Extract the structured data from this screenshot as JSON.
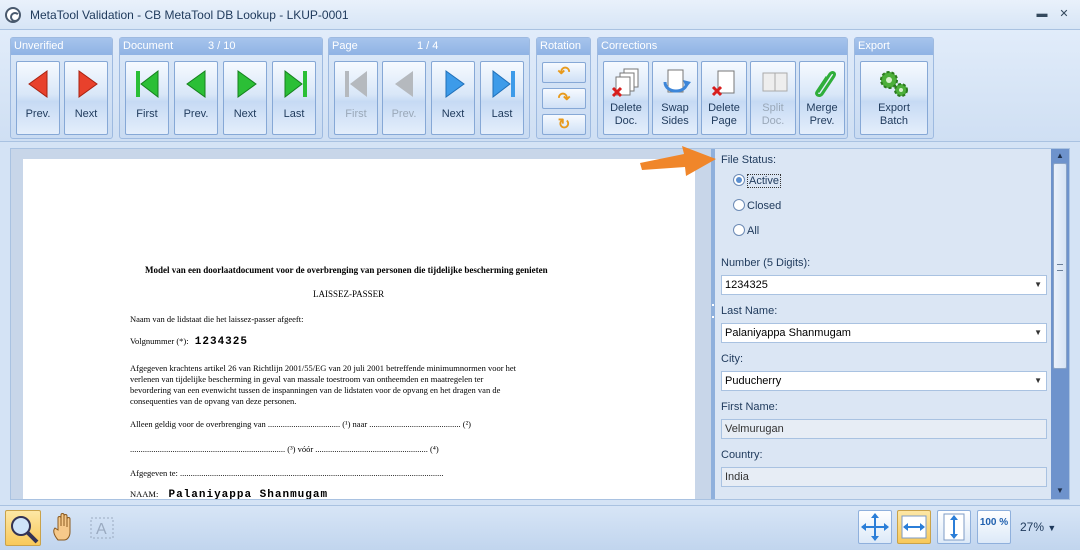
{
  "window": {
    "title": "MetaTool Validation - CB MetaTool DB Lookup - LKUP-0001"
  },
  "ribbon": {
    "unverified": {
      "title": "Unverified",
      "prev": "Prev.",
      "next": "Next"
    },
    "document": {
      "title": "Document",
      "counter": "3 / 10",
      "first": "First",
      "prev": "Prev.",
      "next": "Next",
      "last": "Last"
    },
    "page": {
      "title": "Page",
      "counter": "1 / 4",
      "first": "First",
      "prev": "Prev.",
      "next": "Next",
      "last": "Last"
    },
    "rotation": {
      "title": "Rotation"
    },
    "corrections": {
      "title": "Corrections",
      "delete_doc": [
        "Delete",
        "Doc."
      ],
      "swap_sides": [
        "Swap",
        "Sides"
      ],
      "delete_page": [
        "Delete",
        "Page"
      ],
      "split_doc": [
        "Split",
        "Doc."
      ],
      "merge_prev": [
        "Merge",
        "Prev."
      ]
    },
    "export": {
      "title": "Export",
      "export_batch": [
        "Export",
        "Batch"
      ]
    }
  },
  "document_page": {
    "heading": "Model van een doorlaatdocument voor de overbrenging van personen die tijdelijke bescherming genieten",
    "subheading": "LAISSEZ-PASSER",
    "line_1": "Naam van de lidstaat die het laissez-passer afgeeft:",
    "volgnummer_label": "Volgnummer (*):",
    "volgnummer_value": "1234325",
    "para": [
      "Afgegeven krachtens artikel 26 van Richtlijn 2001/55/EG van 20 juli 2001 betreffende minimumnormen voor het",
      "verlenen van tijdelijke bescherming in geval van massale toestroom van ontheemden en maatregelen ter",
      "bevordering van een evenwicht tussen de inspanningen van de lidstaten voor de opvang en het dragen van de",
      "consequenties van de opvang van deze personen."
    ],
    "line_geldig": "Alleen geldig voor de overbrenging van .................................. (¹)  naar ........................................... (²)",
    "line_voor": "......................................................................... (³) vóór ..................................................... (⁴)",
    "line_afgegeven": "Afgegeven te: ............................................................................................................................",
    "naam_label": "NAAM:",
    "naam_value": "Palaniyappa Shanmugam"
  },
  "form": {
    "file_status_label": "File Status:",
    "status_options": [
      "Active",
      "Closed",
      "All"
    ],
    "selected_status": "Active",
    "number_label": "Number (5 Digits):",
    "number_value": "1234325",
    "last_name_label": "Last Name:",
    "last_name_value": "Palaniyappa Shanmugam",
    "city_label": "City:",
    "city_value": "Puducherry",
    "first_name_label": "First Name:",
    "first_name_value": "Velmurugan",
    "country_label": "Country:",
    "country_value": "India"
  },
  "statusbar": {
    "zoom": "27%",
    "actual_size_label": "100 %"
  },
  "colors": {
    "ribbon_header": "#8fb3e4",
    "arrow_red": "#e8412c",
    "arrow_green": "#2bbf36",
    "arrow_blue": "#3d9be9",
    "pointer_orange": "#f0862a"
  }
}
